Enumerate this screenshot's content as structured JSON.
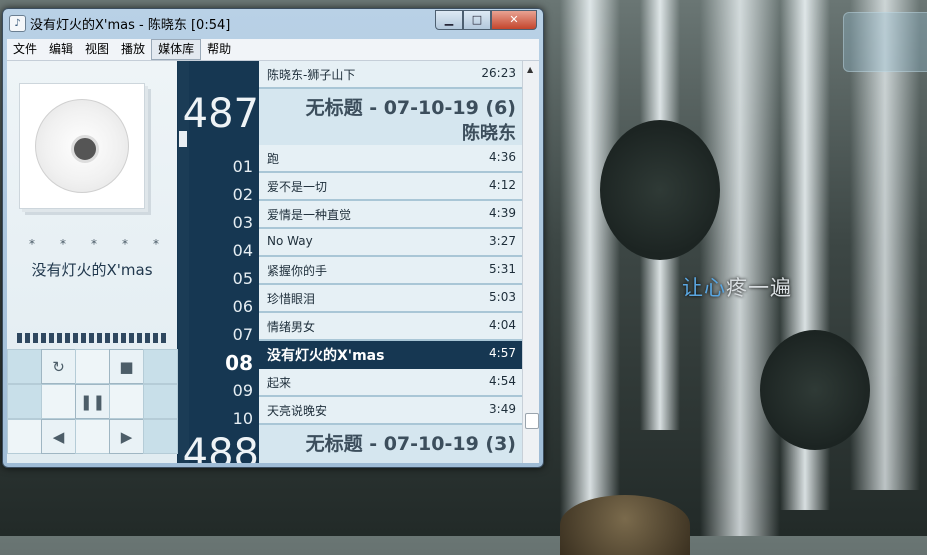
{
  "window": {
    "title": "没有灯火的X'mas - 陈晓东 [0:54]",
    "controls": [
      "0",
      "1",
      "r"
    ]
  },
  "menu": {
    "items": [
      "文件",
      "编辑",
      "视图",
      "播放",
      "媒体库",
      "帮助"
    ]
  },
  "now_playing": {
    "song": "没有灯火的X'mas",
    "stars": [
      "*",
      "*",
      "*",
      "*",
      "*"
    ]
  },
  "prev_track": {
    "title": "陈晓东-狮子山下",
    "duration": "26:23"
  },
  "album_487": {
    "number": "487",
    "title": "无标题 - 07-10-19 (6)",
    "artist": "陈晓东"
  },
  "tracks": [
    {
      "no": "01",
      "title": "跑",
      "duration": "4:36"
    },
    {
      "no": "02",
      "title": "爱不是一切",
      "duration": "4:12"
    },
    {
      "no": "03",
      "title": "爱情是一种直觉",
      "duration": "4:39"
    },
    {
      "no": "04",
      "title": "No Way",
      "duration": "3:27"
    },
    {
      "no": "05",
      "title": "紧握你的手",
      "duration": "5:31"
    },
    {
      "no": "06",
      "title": "珍惜眼泪",
      "duration": "5:03"
    },
    {
      "no": "07",
      "title": "情绪男女",
      "duration": "4:04"
    },
    {
      "no": "08",
      "title": "没有灯火的X'mas",
      "duration": "4:57"
    },
    {
      "no": "09",
      "title": "起来",
      "duration": "4:54"
    },
    {
      "no": "10",
      "title": "天亮说晚安",
      "duration": "3:49"
    }
  ],
  "album_488": {
    "number": "488",
    "title": "无标题 - 07-10-19 (3)"
  },
  "desktop": {
    "lyric_hl": "让心",
    "lyric_rest": "疼一遍"
  },
  "colors": {
    "accent": "#163752",
    "list_bg": "#d5e6ef"
  }
}
